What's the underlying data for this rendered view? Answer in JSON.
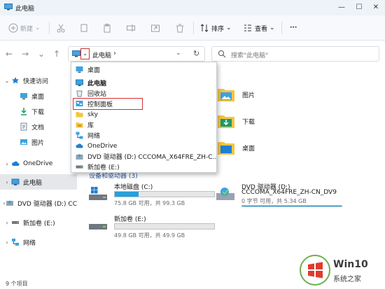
{
  "window": {
    "title": "此电脑",
    "controls": [
      "minimize",
      "maximize",
      "close"
    ]
  },
  "toolbar": {
    "new_label": "新建",
    "sort_label": "排序",
    "view_label": "查看",
    "more_label": "···"
  },
  "address": {
    "path_label": "此电脑",
    "separator": "›",
    "search_placeholder": "搜索\"此电脑\""
  },
  "sidebar": {
    "items": [
      {
        "label": "快速访问",
        "icon": "star-icon"
      },
      {
        "label": "桌面",
        "icon": "desktop-icon"
      },
      {
        "label": "下载",
        "icon": "download-icon"
      },
      {
        "label": "文档",
        "icon": "document-icon"
      },
      {
        "label": "图片",
        "icon": "pictures-icon"
      },
      {
        "label": "OneDrive",
        "icon": "cloud-icon"
      },
      {
        "label": "此电脑",
        "icon": "pc-icon"
      },
      {
        "label": "DVD 驱动器 (D:) CC",
        "icon": "dvd-icon"
      },
      {
        "label": "新加卷 (E:)",
        "icon": "drive-icon"
      },
      {
        "label": "网络",
        "icon": "network-icon"
      }
    ]
  },
  "dropdown": {
    "items": [
      {
        "label": "桌面",
        "icon": "desktop-icon"
      },
      {
        "label": "此电脑",
        "icon": "pc-icon"
      },
      {
        "label": "回收站",
        "icon": "recycle-bin-icon"
      },
      {
        "label": "控制面板",
        "icon": "control-panel-icon"
      },
      {
        "label": "sky",
        "icon": "folder-icon"
      },
      {
        "label": "库",
        "icon": "library-icon"
      },
      {
        "label": "网络",
        "icon": "network-icon"
      },
      {
        "label": "OneDrive",
        "icon": "cloud-icon"
      },
      {
        "label": "DVD 驱动器 (D:) CCCOMA_X64FRE_ZH-C...",
        "icon": "dvd-icon"
      },
      {
        "label": "新加卷 (E:)",
        "icon": "drive-icon"
      }
    ]
  },
  "folders": [
    {
      "label": "图片",
      "icon": "pictures-icon"
    },
    {
      "label": "下载",
      "icon": "download-icon"
    },
    {
      "label": "桌面",
      "icon": "desktop-icon"
    }
  ],
  "section_header": "设备和驱动器 (3)",
  "drives": [
    {
      "name": "本地磁盘 (C:)",
      "info": "75.8 GB 可用，共 99.3 GB",
      "used_fraction": 0.24,
      "icon": "windows-drive-icon"
    },
    {
      "name": "新加卷 (E:)",
      "info": "49.8 GB 可用，共 49.9 GB",
      "used_fraction": 0.0,
      "icon": "drive-icon"
    },
    {
      "name": "DVD 驱动器 (D:)",
      "name2": "CCCOMA_X64FRE_ZH-CN_DV9",
      "info": "0 字节 可用，共 5.34 GB",
      "used_fraction": 1.0,
      "icon": "dvd-icon"
    }
  ],
  "status": {
    "count": "9 个项目"
  },
  "watermark": {
    "title": "Win10",
    "subtitle": "系统之家"
  },
  "colors": {
    "accent": "#26a0da",
    "highlight_border": "#d32f2f",
    "selection": "#e5e7ea"
  }
}
